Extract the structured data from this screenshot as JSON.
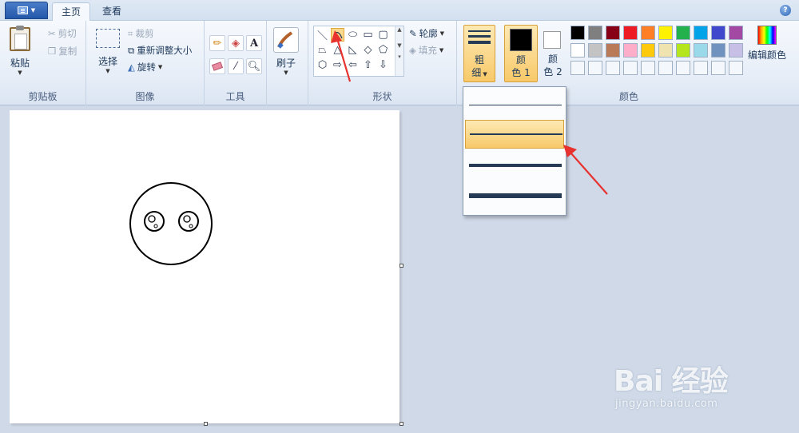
{
  "tabs": {
    "home": "主页",
    "view": "查看"
  },
  "clipboard": {
    "paste": "粘贴",
    "cut": "剪切",
    "copy": "复制",
    "group_label": "剪贴板"
  },
  "image": {
    "select": "选择",
    "crop": "裁剪",
    "resize": "重新调整大小",
    "rotate": "旋转",
    "group_label": "图像"
  },
  "tools": {
    "group_label": "工具",
    "text_glyph": "A"
  },
  "brushes": {
    "label": "刷子"
  },
  "shapes": {
    "outline": "轮廓",
    "fill": "填充",
    "group_label": "形状"
  },
  "size": {
    "label_line1": "粗",
    "label_line2": "细"
  },
  "colors": {
    "color1_line1": "颜",
    "color1_line2": "色 1",
    "color2_line1": "颜",
    "color2_line2": "色 2",
    "edit": "编辑颜色",
    "group_label": "颜色",
    "color1_value": "#000000",
    "color2_value": "#ffffff",
    "palette_row1": [
      "#000000",
      "#7f7f7f",
      "#880015",
      "#ed1c24",
      "#ff7f27",
      "#fff200",
      "#22b14c",
      "#00a2e8",
      "#3f48cc",
      "#a349a4"
    ],
    "palette_row2": [
      "#ffffff",
      "#c3c3c3",
      "#b97a57",
      "#ffaec9",
      "#ffc90e",
      "#efe4b0",
      "#b5e61d",
      "#99d9ea",
      "#7092be",
      "#c8bfe7"
    ]
  },
  "watermark": {
    "brand": "Bai 经验",
    "url": "jingyan.baidu.com"
  }
}
